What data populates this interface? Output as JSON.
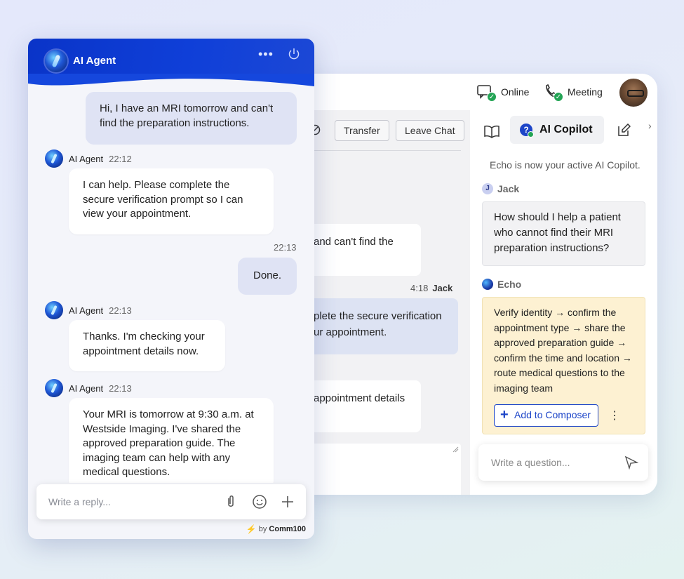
{
  "console": {
    "status_online": "Online",
    "status_meeting": "Meeting",
    "toolbar": {
      "transfer": "Transfer",
      "leave_chat": "Leave Chat"
    },
    "messages": {
      "m1": "and can't find the",
      "m2_line1": "plete the secure verification",
      "m2_line2": "ur appointment.",
      "m3": "appointment details"
    },
    "meta_time": "4:18",
    "meta_name": "Jack"
  },
  "copilot": {
    "tab_label": "AI Copilot",
    "info": "Echo is now your active AI Copilot.",
    "jack_initial": "J",
    "jack_name": "Jack",
    "jack_message": "How should I help a patient who cannot find their MRI preparation instructions?",
    "echo_name": "Echo",
    "echo_message": "Verify identity → confirm the appointment type → share the approved preparation guide → confirm the time and location → route medical questions to the imaging team",
    "add_button": "Add to Composer",
    "input_placeholder": "Write a question..."
  },
  "widget": {
    "title": "AI Agent",
    "messages": [
      {
        "role": "user",
        "text": "Hi, I have an MRI tomorrow and can't find the preparation instructions."
      },
      {
        "role": "bot",
        "name": "AI Agent",
        "time": "22:12",
        "text": "I can help. Please complete the secure verification prompt so I can view your appointment."
      },
      {
        "role": "user",
        "time": "22:13",
        "text": "Done."
      },
      {
        "role": "bot",
        "name": "AI Agent",
        "time": "22:13",
        "text": "Thanks. I'm checking your appointment details now."
      },
      {
        "role": "bot",
        "name": "AI Agent",
        "time": "22:13",
        "text": "Your MRI is tomorrow at 9:30 a.m. at Westside Imaging. I've shared the approved preparation guide. The imaging team can help with any medical questions."
      }
    ],
    "reply_placeholder": "Write a reply...",
    "powered_by": "by",
    "brand": "Comm100"
  },
  "colors": {
    "accent": "#1d45c8",
    "header": "#0f3fd8",
    "echo_bg": "#fdf1d2",
    "online": "#23a455"
  }
}
